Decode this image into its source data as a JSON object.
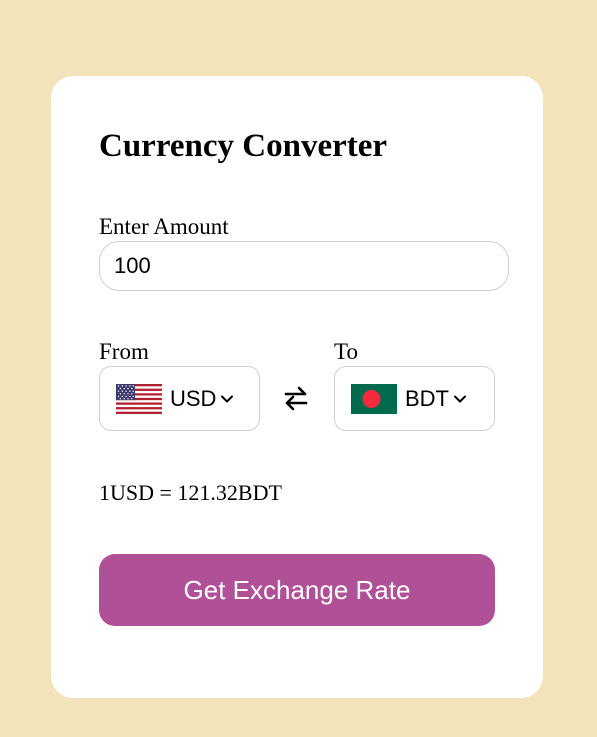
{
  "app": {
    "title": "Currency Converter"
  },
  "amount": {
    "label": "Enter Amount",
    "value": "100"
  },
  "from": {
    "label": "From",
    "currency": "USD",
    "flag_icon": "us-flag-icon"
  },
  "to": {
    "label": "To",
    "currency": "BDT",
    "flag_icon": "bd-flag-icon"
  },
  "swap": {
    "icon": "swap-arrows-icon"
  },
  "result": {
    "text": "1USD = 121.32BDT"
  },
  "action": {
    "button_label": "Get Exchange Rate"
  },
  "colors": {
    "background": "#f3e3bb",
    "card": "#ffffff",
    "button": "#b05096",
    "bd_flag_green": "#006a4e",
    "bd_flag_red": "#f42a41"
  }
}
